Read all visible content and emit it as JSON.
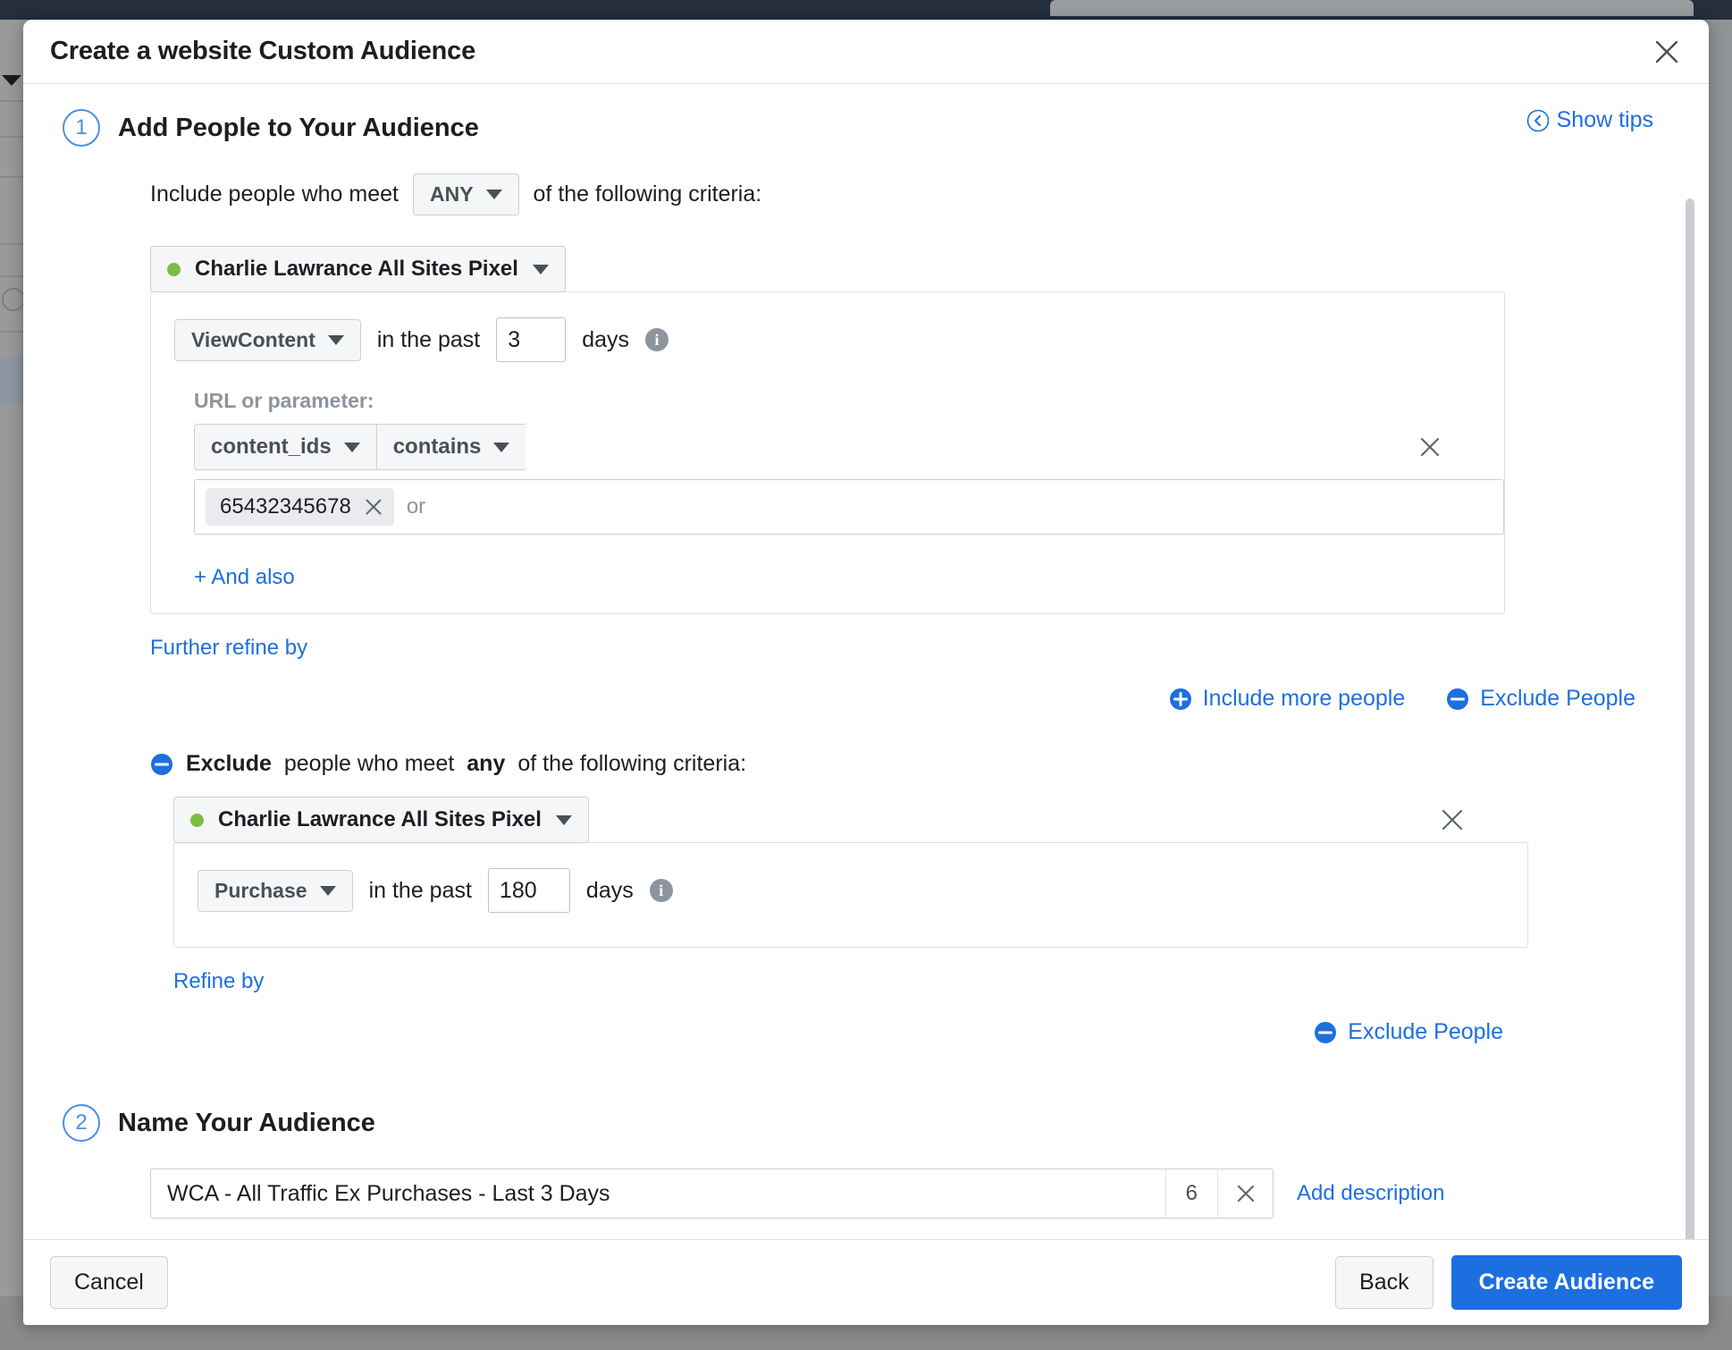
{
  "modal": {
    "title": "Create a website Custom Audience",
    "close_icon": "close-icon",
    "show_tips": {
      "label": "Show tips",
      "icon": "circle-chevron-left-icon"
    }
  },
  "step1": {
    "number": "1",
    "title": "Add People to Your Audience",
    "sentence_prefix": "Include people who meet",
    "match_selector": "ANY",
    "sentence_suffix": "of the following criteria:",
    "pixel": {
      "name": "Charlie Lawrance All Sites Pixel",
      "status_color": "#7bbd42"
    },
    "rule": {
      "event": "ViewContent",
      "in_the_past": "in the past",
      "days_value": "3",
      "days_label": "days",
      "info_icon": "info-icon"
    },
    "url_parameter_label": "URL or parameter:",
    "param": {
      "field": "content_ids",
      "operator": "contains",
      "tokens": [
        "65432345678"
      ],
      "placeholder": "or",
      "remove_icon": "close-icon"
    },
    "and_also": "+ And also",
    "further_refine": "Further refine by",
    "actions": [
      {
        "label": "Include more people",
        "icon": "plus-circle-icon",
        "color": "#1d6fe0"
      },
      {
        "label": "Exclude People",
        "icon": "minus-circle-icon",
        "color": "#1d6fe0"
      }
    ]
  },
  "exclude": {
    "icon": "minus-circle-icon",
    "word_exclude": "Exclude",
    "mid_text": "people who meet",
    "word_any": "any",
    "tail_text": "of the following criteria:",
    "pixel": {
      "name": "Charlie Lawrance All Sites Pixel",
      "status_color": "#7bbd42"
    },
    "rule": {
      "event": "Purchase",
      "in_the_past": "in the past",
      "days_value": "180",
      "days_label": "days",
      "info_icon": "info-icon"
    },
    "refine_by": "Refine by",
    "exclude_action": {
      "label": "Exclude People",
      "icon": "minus-circle-icon"
    },
    "remove_icon": "close-icon"
  },
  "step2": {
    "number": "2",
    "title": "Name Your Audience",
    "name_value": "WCA - All Traffic Ex Purchases - Last 3 Days",
    "char_count": "6",
    "clear_icon": "close-icon",
    "add_description": "Add description"
  },
  "footer": {
    "cancel": "Cancel",
    "back": "Back",
    "create": "Create Audience",
    "primary_color": "#1d6fe0"
  }
}
